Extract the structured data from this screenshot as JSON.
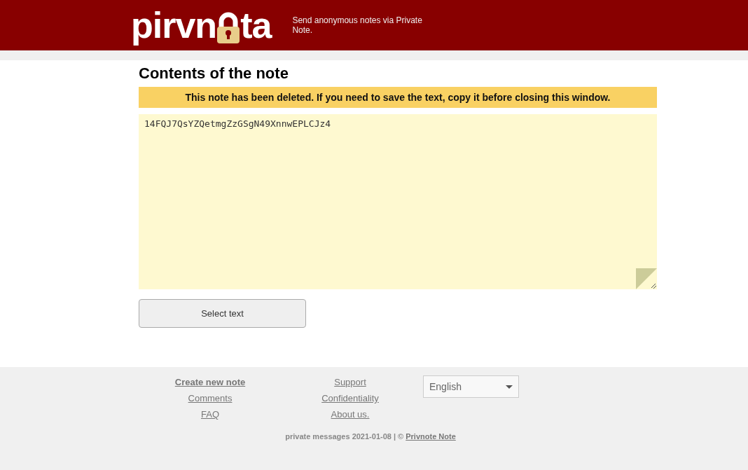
{
  "header": {
    "logo_before": "pirvn",
    "logo_after": "ta",
    "tagline": "Send anonymous notes via Private Note."
  },
  "note": {
    "title": "Contents of the note",
    "alert": "This note has been deleted. If you need to save the text, copy it before closing this window.",
    "text": "14FQJ7QsYZQetmgZzGSgN49XnnwEPLCJz4",
    "button": "Select text"
  },
  "footer": {
    "columns": [
      [
        {
          "label": "Create new note",
          "bold": true
        },
        {
          "label": "Comments",
          "bold": false
        },
        {
          "label": "FAQ",
          "bold": false
        }
      ],
      [
        {
          "label": "Support",
          "bold": false
        },
        {
          "label": "Confidentiality",
          "bold": false
        },
        {
          "label": "About us.",
          "bold": false
        }
      ]
    ],
    "language": "English",
    "copyright": "private messages 2021-01-08 | ©",
    "copyright_link": "Privnote Note"
  }
}
